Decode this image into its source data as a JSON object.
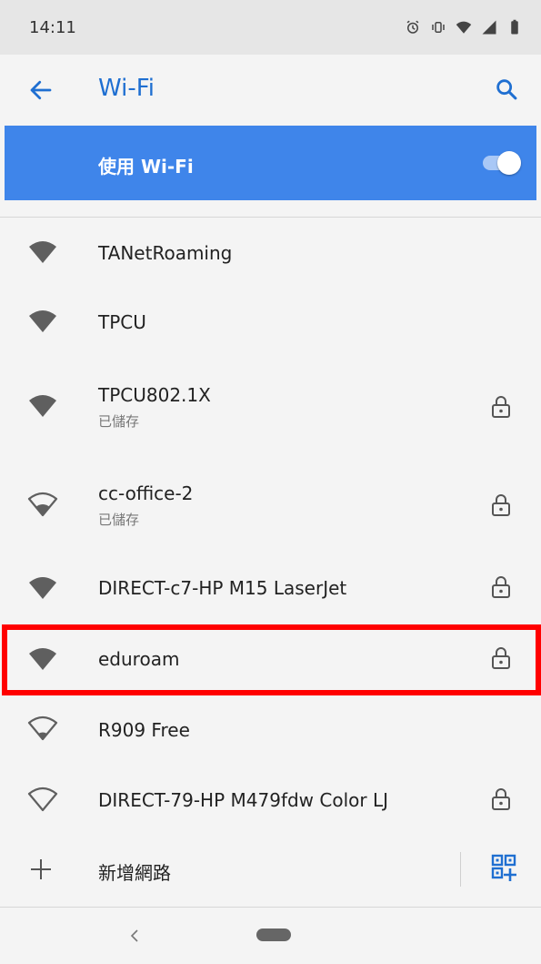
{
  "status_bar": {
    "time": "14:11",
    "icons": [
      "alarm-icon",
      "vibrate-icon",
      "wifi-signal-icon",
      "cell-signal-icon",
      "battery-icon"
    ]
  },
  "app_bar": {
    "title": "Wi-Fi",
    "back_icon": "arrow-back-icon",
    "search_icon": "search-icon"
  },
  "wifi_toggle": {
    "label": "使用 Wi-Fi",
    "enabled": true,
    "accent_color": "#3f85ea"
  },
  "networks": [
    {
      "name": "TANetRoaming",
      "secured": false,
      "signal": "full"
    },
    {
      "name": "TPCU",
      "secured": false,
      "signal": "full"
    },
    {
      "name": "TPCU802.1X",
      "status": "已儲存",
      "secured": true,
      "signal": "full"
    },
    {
      "name": "cc-office-2",
      "status": "已儲存",
      "secured": true,
      "signal": "medium"
    },
    {
      "name": "DIRECT-c7-HP M15 LaserJet",
      "secured": true,
      "signal": "full"
    },
    {
      "name": "eduroam",
      "secured": true,
      "signal": "full",
      "highlighted": true
    },
    {
      "name": "R909 Free",
      "secured": false,
      "signal": "weak"
    },
    {
      "name": "DIRECT-79-HP M479fdw Color LJ",
      "secured": true,
      "signal": "empty"
    }
  ],
  "add_network": {
    "label": "新增網路",
    "plus_icon": "plus-icon",
    "qr_icon": "qr-code-scan-icon"
  },
  "highlight_color": "#ff0000",
  "nav_bar": {
    "back_icon": "nav-back-icon",
    "home_icon": "home-pill-icon"
  }
}
